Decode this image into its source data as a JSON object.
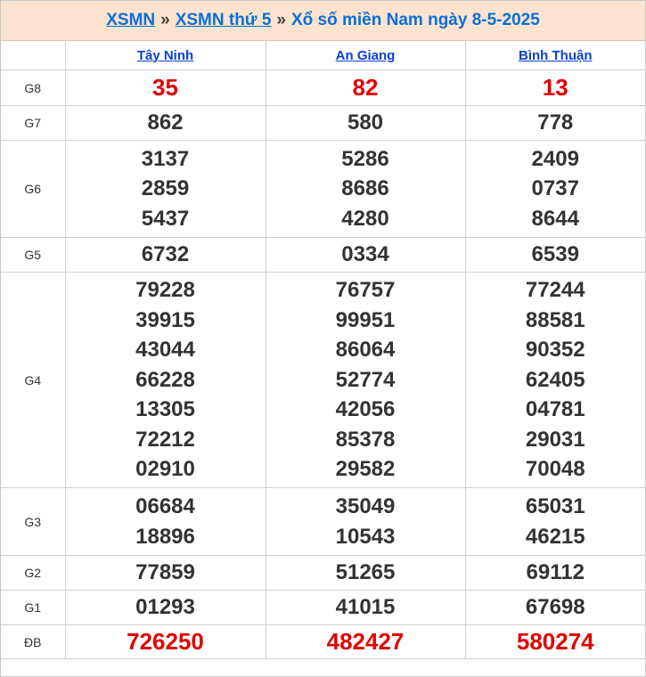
{
  "header": {
    "link1": "XSMN",
    "sep1": "»",
    "link2": "XSMN thứ 5",
    "sep2": "»",
    "tail": "Xổ số miền Nam ngày 8-5-2025"
  },
  "provinces": [
    "Tây Ninh",
    "An Giang",
    "Bình Thuận"
  ],
  "colors": {
    "accent": "#0b6fd6",
    "special": "#e00000",
    "header_bg": "#fbe3d0"
  },
  "prizes": [
    {
      "label": "G8",
      "values": [
        [
          "35"
        ],
        [
          "82"
        ],
        [
          "13"
        ]
      ]
    },
    {
      "label": "G7",
      "values": [
        [
          "862"
        ],
        [
          "580"
        ],
        [
          "778"
        ]
      ]
    },
    {
      "label": "G6",
      "values": [
        [
          "3137",
          "2859",
          "5437"
        ],
        [
          "5286",
          "8686",
          "4280"
        ],
        [
          "2409",
          "0737",
          "8644"
        ]
      ]
    },
    {
      "label": "G5",
      "values": [
        [
          "6732"
        ],
        [
          "0334"
        ],
        [
          "6539"
        ]
      ]
    },
    {
      "label": "G4",
      "values": [
        [
          "79228",
          "39915",
          "43044",
          "66228",
          "13305",
          "72212",
          "02910"
        ],
        [
          "76757",
          "99951",
          "86064",
          "52774",
          "42056",
          "85378",
          "29582"
        ],
        [
          "77244",
          "88581",
          "90352",
          "62405",
          "04781",
          "29031",
          "70048"
        ]
      ]
    },
    {
      "label": "G3",
      "values": [
        [
          "06684",
          "18896"
        ],
        [
          "35049",
          "10543"
        ],
        [
          "65031",
          "46215"
        ]
      ]
    },
    {
      "label": "G2",
      "values": [
        [
          "77859"
        ],
        [
          "51265"
        ],
        [
          "69112"
        ]
      ]
    },
    {
      "label": "G1",
      "values": [
        [
          "01293"
        ],
        [
          "41015"
        ],
        [
          "67698"
        ]
      ]
    },
    {
      "label": "ĐB",
      "values": [
        [
          "726250"
        ],
        [
          "482427"
        ],
        [
          "580274"
        ]
      ]
    }
  ]
}
